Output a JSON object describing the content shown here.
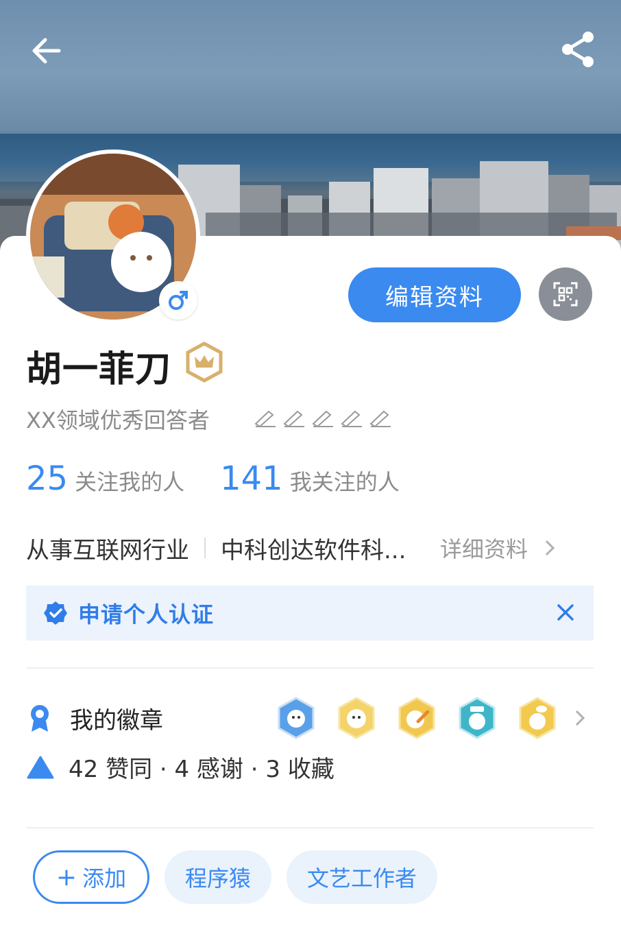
{
  "header": {
    "back_icon": "back-arrow-icon",
    "share_icon": "share-icon"
  },
  "profile": {
    "name": "胡一菲刀",
    "gender_icon": "male-icon",
    "level_icon": "crown-icon",
    "title": "XX领域优秀回答者",
    "pens_count": 5,
    "edit_button": "编辑资料",
    "qr_icon": "qr-code-icon"
  },
  "stats": {
    "followers_count": "25",
    "followers_label": "关注我的人",
    "following_count": "141",
    "following_label": "我关注的人"
  },
  "career": {
    "industry": "从事互联网行业",
    "company": "中科创达软件科...",
    "detail_link": "详细资料"
  },
  "verify_banner": {
    "text": "申请个人认证",
    "color": "#2f7de8"
  },
  "badges": {
    "label": "我的徽章",
    "medals": [
      "badge-blue-icon",
      "badge-gold-icon",
      "badge-gold-pen-icon",
      "badge-teal-icon",
      "badge-gold-chat-icon"
    ]
  },
  "votes": {
    "text": "42 赞同 · 4 感谢 · 3 收藏"
  },
  "tags": {
    "add_label": "添加",
    "items": [
      "程序猿",
      "文艺工作者"
    ]
  },
  "colors": {
    "accent": "#3a8af0",
    "muted": "#8b8b8b"
  }
}
